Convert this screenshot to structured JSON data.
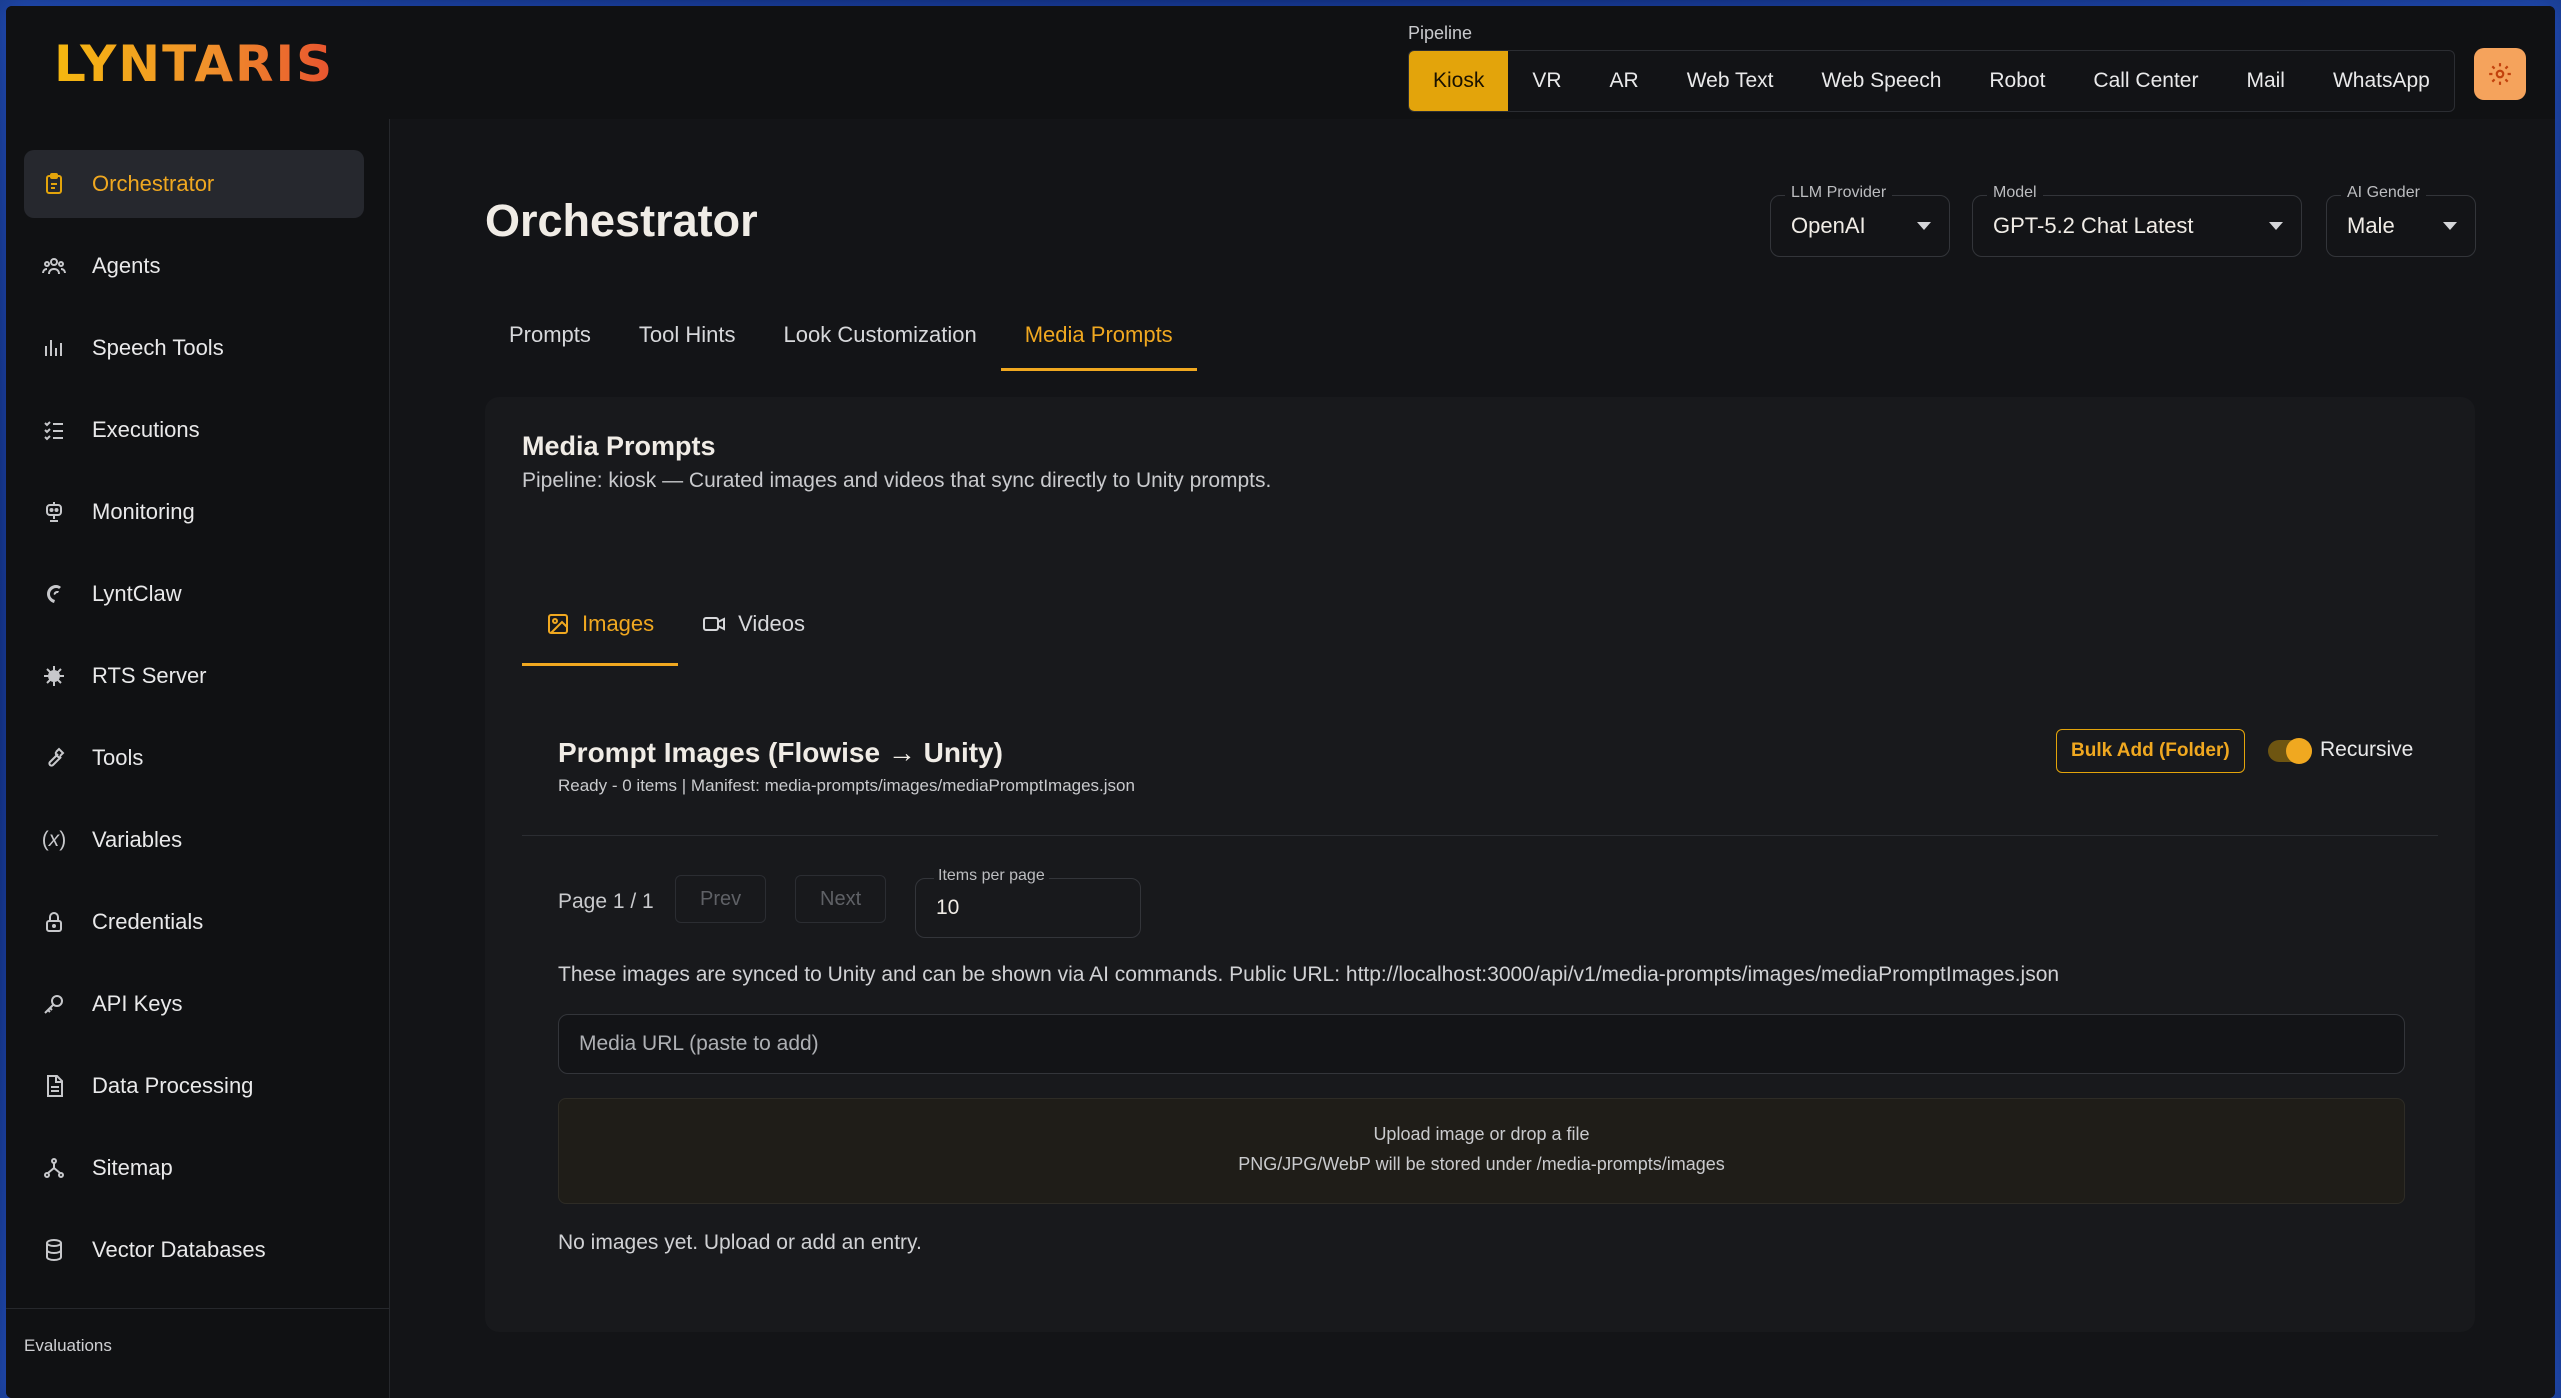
{
  "app": {
    "logo": "LYNTARIS"
  },
  "pipeline": {
    "label": "Pipeline",
    "options": [
      "Kiosk",
      "VR",
      "AR",
      "Web Text",
      "Web Speech",
      "Robot",
      "Call Center",
      "Mail",
      "WhatsApp"
    ],
    "selected": "Kiosk"
  },
  "sidebar": {
    "items": [
      {
        "label": "Orchestrator",
        "icon": "clipboard-icon",
        "active": true
      },
      {
        "label": "Agents",
        "icon": "users-icon"
      },
      {
        "label": "Speech Tools",
        "icon": "bar-chart-icon"
      },
      {
        "label": "Executions",
        "icon": "list-check-icon"
      },
      {
        "label": "Monitoring",
        "icon": "robot-icon"
      },
      {
        "label": "LyntClaw",
        "icon": "claw-icon"
      },
      {
        "label": "RTS Server",
        "icon": "server-icon"
      },
      {
        "label": "Tools",
        "icon": "wrench-icon"
      },
      {
        "label": "Variables",
        "icon": "variable-icon"
      },
      {
        "label": "Credentials",
        "icon": "lock-icon"
      },
      {
        "label": "API Keys",
        "icon": "key-icon"
      },
      {
        "label": "Data Processing",
        "icon": "document-icon"
      },
      {
        "label": "Sitemap",
        "icon": "sitemap-icon"
      },
      {
        "label": "Vector Databases",
        "icon": "database-icon"
      }
    ],
    "section_label": "Evaluations"
  },
  "header": {
    "title": "Orchestrator",
    "llm_provider": {
      "label": "LLM Provider",
      "value": "OpenAI"
    },
    "model": {
      "label": "Model",
      "value": "GPT-5.2 Chat Latest"
    },
    "ai_gender": {
      "label": "AI Gender",
      "value": "Male"
    }
  },
  "tabs": [
    "Prompts",
    "Tool Hints",
    "Look Customization",
    "Media Prompts"
  ],
  "active_tab": "Media Prompts",
  "card": {
    "title": "Media Prompts",
    "subtitle": "Pipeline: kiosk — Curated images and videos that sync directly to Unity prompts.",
    "subtabs": [
      "Images",
      "Videos"
    ],
    "section": {
      "title": "Prompt Images (Flowise → Unity)",
      "status": "Ready - 0 items | Manifest: media-prompts/images/mediaPromptImages.json",
      "bulk_add": "Bulk Add (Folder)",
      "recursive": "Recursive",
      "recursive_on": true,
      "page_info": "Page 1 / 1",
      "prev": "Prev",
      "next": "Next",
      "items_per_page_label": "Items per page",
      "items_per_page": "10",
      "info": "These images are synced to Unity and can be shown via AI commands. Public URL: http://localhost:3000/api/v1/media-prompts/images/mediaPromptImages.json",
      "url_placeholder": "Media URL (paste to add)",
      "dropzone_line1": "Upload image or drop a file",
      "dropzone_line2": "PNG/JPG/WebP will be stored under /media-prompts/images",
      "empty": "No images yet. Upload or add an entry."
    }
  },
  "colors": {
    "accent": "#e3a40b",
    "background": "#131417",
    "sidebar": "#101113"
  }
}
